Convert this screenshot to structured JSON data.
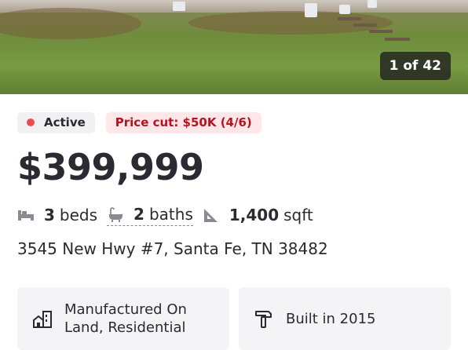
{
  "photo": {
    "counter": "1 of 42"
  },
  "status": {
    "label": "Active",
    "dot_color": "#ec4c4c"
  },
  "price_cut": {
    "label": "Price cut: $50K (4/6)",
    "color": "#b8131d",
    "bg": "#ffe6e8"
  },
  "price": "$399,999",
  "facts": {
    "beds_value": "3",
    "beds_label": "beds",
    "baths_value": "2",
    "baths_label": "baths",
    "sqft_value": "1,400",
    "sqft_label": "sqft",
    "icons": [
      "bed-icon",
      "bathtub-icon",
      "ruler-triangle-icon"
    ]
  },
  "address": "3545 New Hwy #7, Santa Fe, TN 38482",
  "cards": [
    {
      "icon": "building-home-icon",
      "text": "Manufactured On Land, Residential"
    },
    {
      "icon": "hammer-icon",
      "text": "Built in 2015"
    }
  ]
}
